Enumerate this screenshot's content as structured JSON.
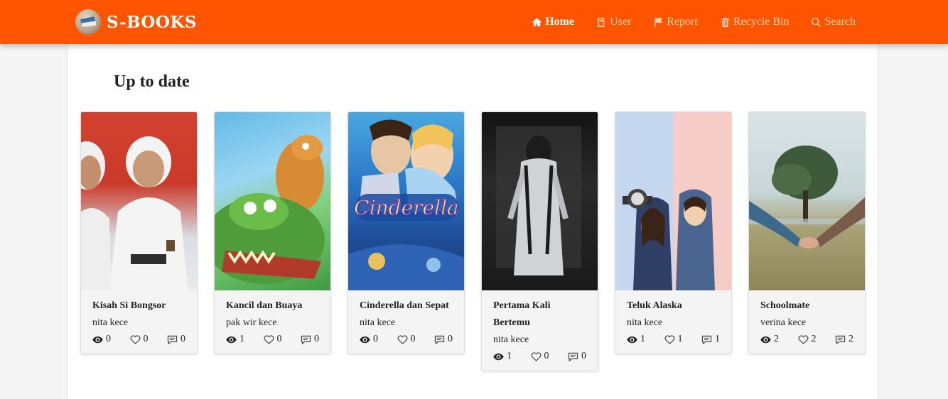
{
  "brand": {
    "name": "S-BOOKS",
    "logo_icon": "book-stack-logo"
  },
  "colors": {
    "navbar": "#ff5500",
    "nav_inactive": "#ffd0b5",
    "nav_active": "#ffffff"
  },
  "nav": {
    "items": [
      {
        "label": "Home",
        "icon": "home-icon",
        "active": true
      },
      {
        "label": "User",
        "icon": "user-icon",
        "active": false
      },
      {
        "label": "Report",
        "icon": "flag-icon",
        "active": false
      },
      {
        "label": "Recycle Bin",
        "icon": "trash-icon",
        "active": false
      },
      {
        "label": "Search",
        "icon": "search-icon",
        "active": false
      }
    ]
  },
  "main": {
    "section_title": "Up to date",
    "books": [
      {
        "title": "Kisah Si Bongsor",
        "author": "nita kece",
        "views": "0",
        "likes": "0",
        "comments": "0"
      },
      {
        "title": "Kancil dan Buaya",
        "author": "pak wir kece",
        "views": "1",
        "likes": "0",
        "comments": "0"
      },
      {
        "title": "Cinderella dan Sepat",
        "author": "nita kece",
        "views": "0",
        "likes": "0",
        "comments": "0"
      },
      {
        "title": "Pertama Kali Bertemu",
        "author": "nita kece",
        "views": "1",
        "likes": "0",
        "comments": "0"
      },
      {
        "title": "Teluk Alaska",
        "author": "nita kece",
        "views": "1",
        "likes": "1",
        "comments": "1"
      },
      {
        "title": "Schoolmate",
        "author": "verina kece",
        "views": "2",
        "likes": "2",
        "comments": "2"
      }
    ]
  }
}
